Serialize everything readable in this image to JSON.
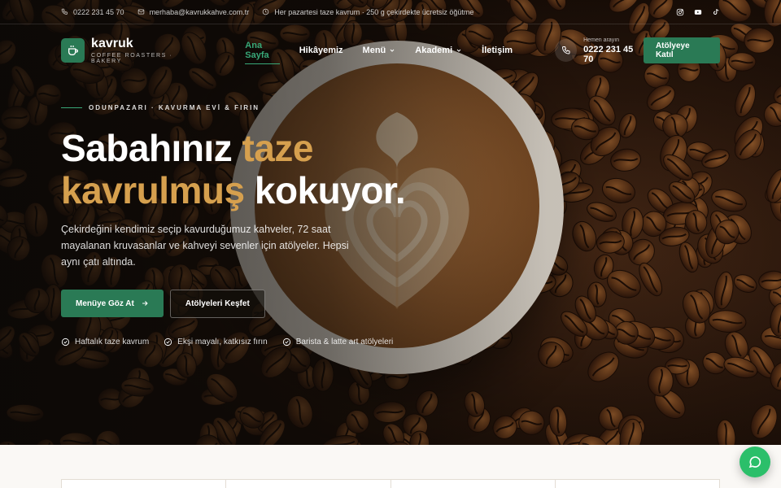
{
  "topbar": {
    "phone": "0222 231 45 70",
    "email": "merhaba@kavrukkahve.com.tr",
    "notice": "Her pazartesi taze kavrum · 250 g çekirdekte ücretsiz öğütme",
    "socials": [
      "instagram-icon",
      "youtube-icon",
      "tiktok-icon"
    ]
  },
  "brand": {
    "name": "kavruk",
    "tagline": "COFFEE ROASTERS · BAKERY",
    "accent": "#2a7a55",
    "gold": "#d6a04e"
  },
  "nav": {
    "items": [
      {
        "label": "Ana Sayfa",
        "active": true
      },
      {
        "label": "Hikâyemiz"
      },
      {
        "label": "Menü",
        "dropdown": true
      },
      {
        "label": "Akademi",
        "dropdown": true
      },
      {
        "label": "İletişim"
      }
    ],
    "call_label": "Hemen arayın",
    "call_number": "0222 231 45 70",
    "cta": "Atölyeye Katıl"
  },
  "hero": {
    "eyebrow": "ODUNPAZARI · KAVURMA EVİ & FIRIN",
    "headline_1": "Sabahınız ",
    "headline_gold_1": "taze",
    "headline_gold_2": "kavrulmuş",
    "headline_2": " kokuyor.",
    "lead": "Çekirdeğini kendimiz seçip kavurduğumuz kahveler, 72 saat mayalanan kruvasanlar ve kahveyi sevenler için atölyeler. Hepsi aynı çatı altında.",
    "primary_button": "Menüye Göz At",
    "secondary_button": "Atölyeleri Keşfet",
    "features": [
      "Haftalık taze kavrum",
      "Ekşi mayalı, katkısız fırın",
      "Barista & latte art atölyeleri"
    ]
  }
}
